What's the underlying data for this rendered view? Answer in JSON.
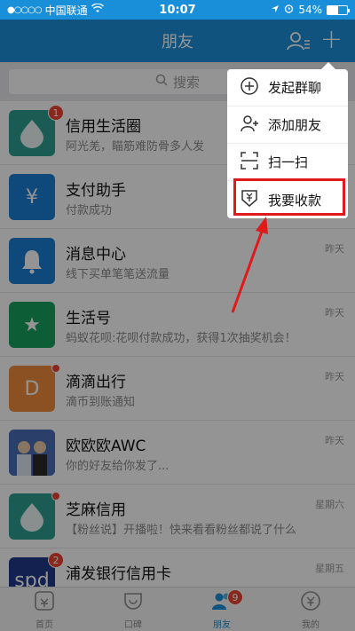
{
  "status_bar": {
    "carrier": "中国联通",
    "time": "10:07",
    "battery": "54%",
    "battery_level": 0.54
  },
  "nav": {
    "title": "朋友",
    "contacts_icon": "contacts-icon",
    "add_icon": "+"
  },
  "search": {
    "placeholder": "搜索"
  },
  "conversations": [
    {
      "name": "信用生活圈",
      "preview": "阿光羌，瞄筋难防骨多人发",
      "time": "",
      "badge": "1",
      "avatar_color": "#2e9e8f",
      "avatar_icon": "drop-icon"
    },
    {
      "name": "支付助手",
      "preview": "付款成功",
      "time": "",
      "badge": "",
      "avatar_color": "#1a7fd4",
      "avatar_icon": "¥"
    },
    {
      "name": "消息中心",
      "preview": "线下买单笔笔送流量",
      "time": "昨天",
      "badge": "",
      "avatar_color": "#1a7fd4",
      "avatar_icon": "bell-icon"
    },
    {
      "name": "生活号",
      "preview": "蚂蚁花呗:花呗付款成功，获得1次抽奖机会！",
      "time": "昨天",
      "badge": "",
      "avatar_color": "#17a05d",
      "avatar_icon": "★"
    },
    {
      "name": "滴滴出行",
      "preview": "滴币到账通知",
      "time": "昨天",
      "badge": "",
      "avatar_color": "#f08c3c",
      "avatar_icon": "D"
    },
    {
      "name": "欧欧欧AWC",
      "preview": "你的好友给你发了...",
      "time": "昨天",
      "badge": "",
      "avatar_color": "#3b5ba5",
      "avatar_icon": "photo-icon"
    },
    {
      "name": "芝麻信用",
      "preview": "【粉丝说】开播啦！快来看看粉丝都说了什么",
      "time": "星期六",
      "badge": "",
      "avatar_color": "#2e9e8f",
      "avatar_icon": "drop-icon"
    },
    {
      "name": "浦发银行信用卡",
      "preview": "",
      "time": "星期五",
      "badge": "2",
      "avatar_color": "#1f3a8a",
      "avatar_icon": "spd"
    }
  ],
  "menu": {
    "items": [
      {
        "label": "发起群聊",
        "icon": "chat-plus-icon"
      },
      {
        "label": "添加朋友",
        "icon": "add-user-icon"
      },
      {
        "label": "扫一扫",
        "icon": "scan-icon"
      },
      {
        "label": "我要收款",
        "icon": "receive-money-icon"
      }
    ]
  },
  "tabs": [
    {
      "label": "首页",
      "icon": "home-icon",
      "active": false,
      "badge": ""
    },
    {
      "label": "口碑",
      "icon": "koubei-icon",
      "active": false,
      "badge": ""
    },
    {
      "label": "朋友",
      "icon": "friends-icon",
      "active": true,
      "badge": "9"
    },
    {
      "label": "我的",
      "icon": "mine-icon",
      "active": false,
      "badge": ""
    }
  ],
  "colors": {
    "brand": "#1a8fd9",
    "badge": "#e43e3e",
    "highlight": "#e0191b"
  }
}
